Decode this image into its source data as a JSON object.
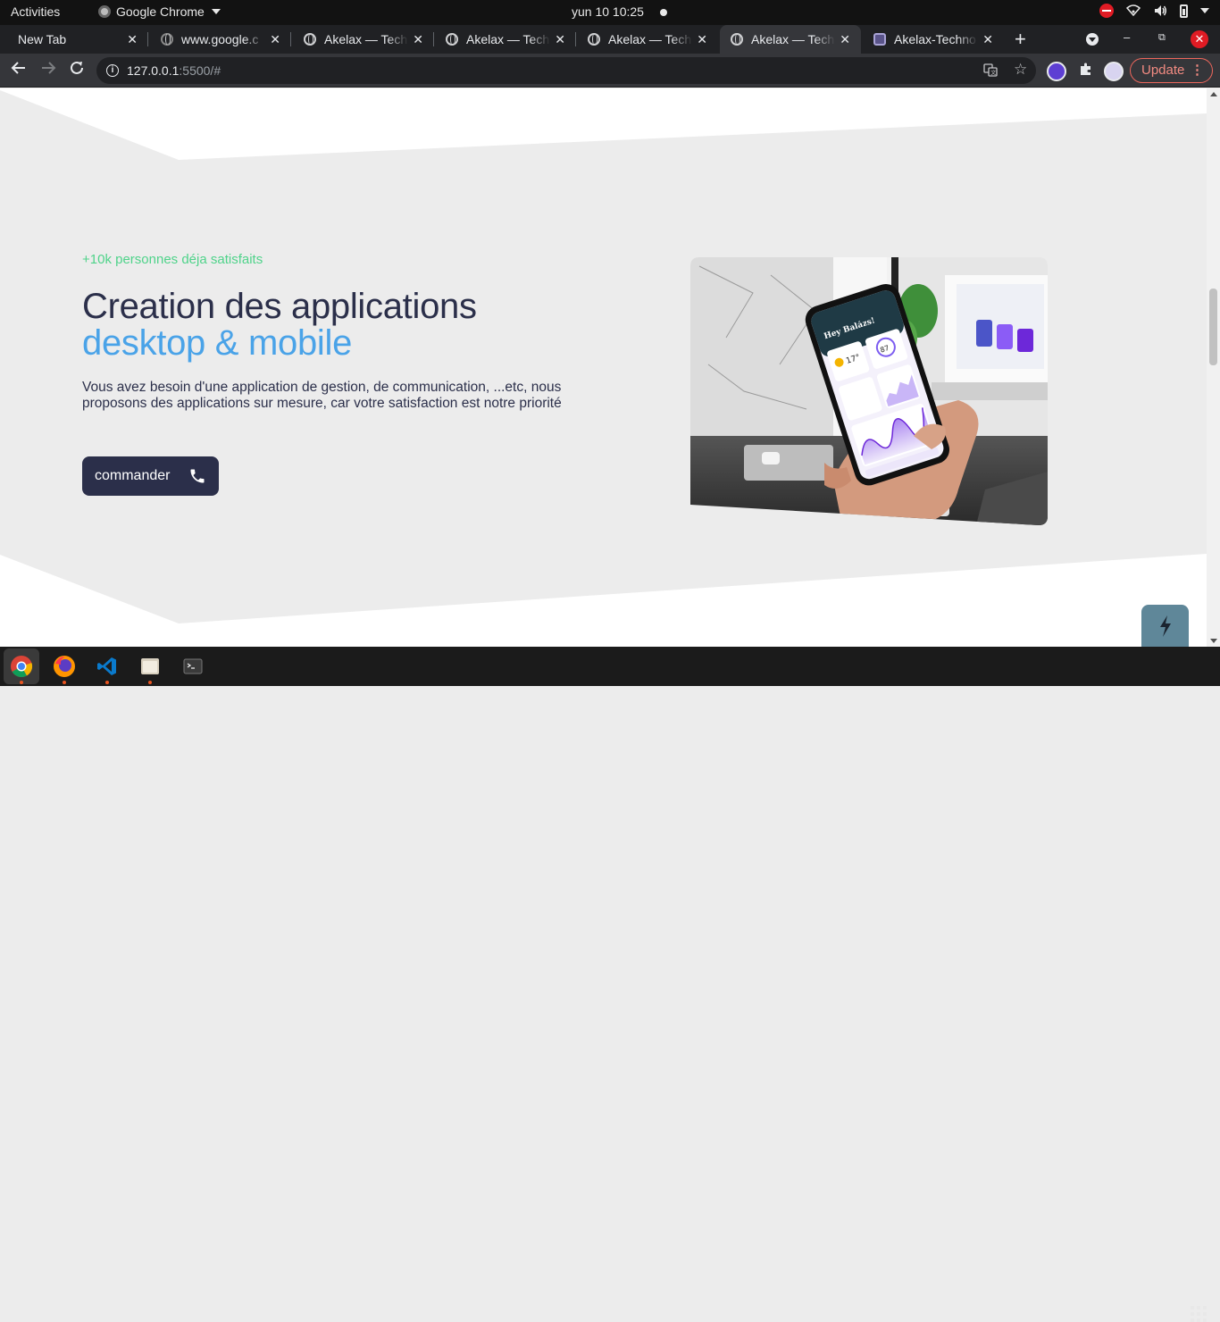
{
  "system_bar": {
    "activities": "Activities",
    "app_name": "Google Chrome",
    "clock": "yun 10  10:25"
  },
  "tabs": [
    {
      "title": "New Tab",
      "icon": "none",
      "active": false
    },
    {
      "title": "www.google.c",
      "icon": "globe-icon",
      "active": false
    },
    {
      "title": "Akelax — Tech",
      "icon": "globe-icon",
      "active": false
    },
    {
      "title": "Akelax — Tech",
      "icon": "globe-icon",
      "active": false
    },
    {
      "title": "Akelax — Tech",
      "icon": "globe-icon",
      "active": false
    },
    {
      "title": "Akelax — Tech",
      "icon": "globe-icon",
      "active": true
    },
    {
      "title": "Akelax-Techno",
      "icon": "akelax-logo-icon",
      "active": false
    }
  ],
  "toolbar": {
    "url_host": "127.0.0.1",
    "url_rest": ":5500/#",
    "update_label": "Update"
  },
  "hero": {
    "eyebrow": "+10k personnes déja satisfaits",
    "title_line1": "Creation des applications",
    "title_line2": "desktop & mobile",
    "description": "Vous avez besoin d'une application de gestion, de communication, ...etc, nous proposons des applications sur mesure, car votre satisfaction est notre priorité",
    "cta_label": "commander"
  },
  "photo": {
    "phone_greeting": "Hey Balázs!",
    "temp": "17°",
    "stat": "87"
  },
  "colors": {
    "navy": "#2b2f4a",
    "accent_blue": "#4aa3e8",
    "accent_green": "#4fd38a",
    "page_bg": "#ececec",
    "fab": "#5f8799"
  },
  "dock": [
    "chrome-icon",
    "firefox-icon",
    "vscode-icon",
    "files-icon",
    "terminal-icon"
  ]
}
